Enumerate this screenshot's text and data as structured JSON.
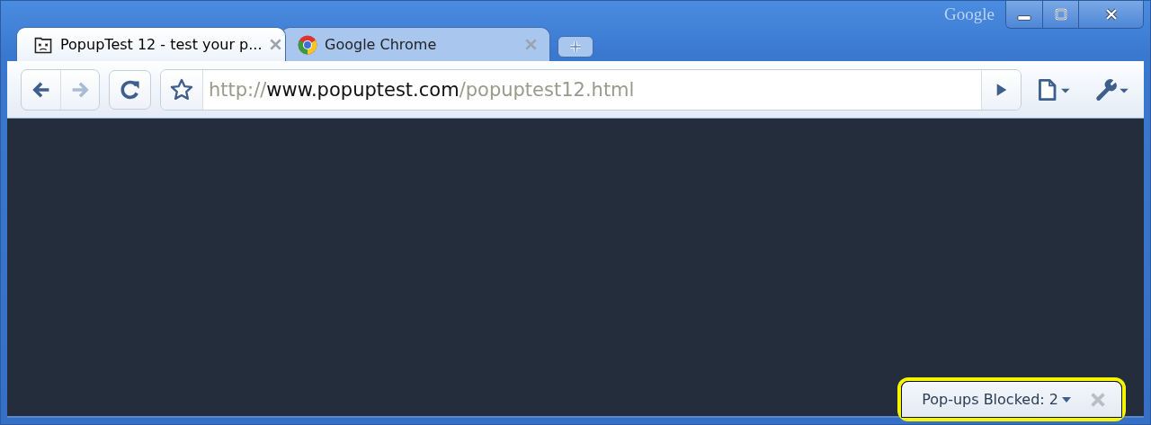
{
  "window": {
    "logo": "Google"
  },
  "tabs": [
    {
      "title": "PopupTest 12 - test your p...",
      "selected": true,
      "kind": "sad-page"
    },
    {
      "title": "Google Chrome",
      "selected": false,
      "kind": "chrome"
    }
  ],
  "address_bar": {
    "scheme": "http://",
    "host": "www.popuptest.com",
    "path": "/popuptest12.html"
  },
  "popup_blocker": {
    "label": "Pop-ups Blocked: 2",
    "highlighted": true
  }
}
